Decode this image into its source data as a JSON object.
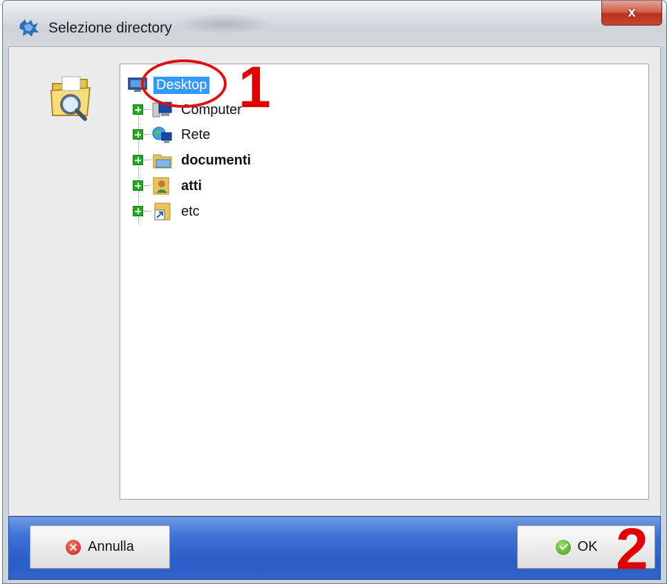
{
  "window": {
    "title": "Selezione directory",
    "close_label": "x"
  },
  "tree": {
    "root": {
      "label": "Desktop",
      "icon": "desktop-icon",
      "selected": true
    },
    "items": [
      {
        "label": "Computer",
        "icon": "computer-icon",
        "bold": false
      },
      {
        "label": "Rete",
        "icon": "network-icon",
        "bold": false
      },
      {
        "label": "documenti",
        "icon": "library-folder-icon",
        "bold": true
      },
      {
        "label": "atti",
        "icon": "user-folder-icon",
        "bold": true
      },
      {
        "label": "etc",
        "icon": "shortcut-folder-icon",
        "bold": false
      }
    ]
  },
  "annotations": {
    "marker_1": "1",
    "marker_2": "2",
    "color": "#e00000"
  },
  "buttons": {
    "cancel_label": "Annulla",
    "ok_label": "OK"
  },
  "colors": {
    "selection": "#3399ff",
    "footer": "#2a5ec7",
    "expander": "#1faa1f"
  }
}
